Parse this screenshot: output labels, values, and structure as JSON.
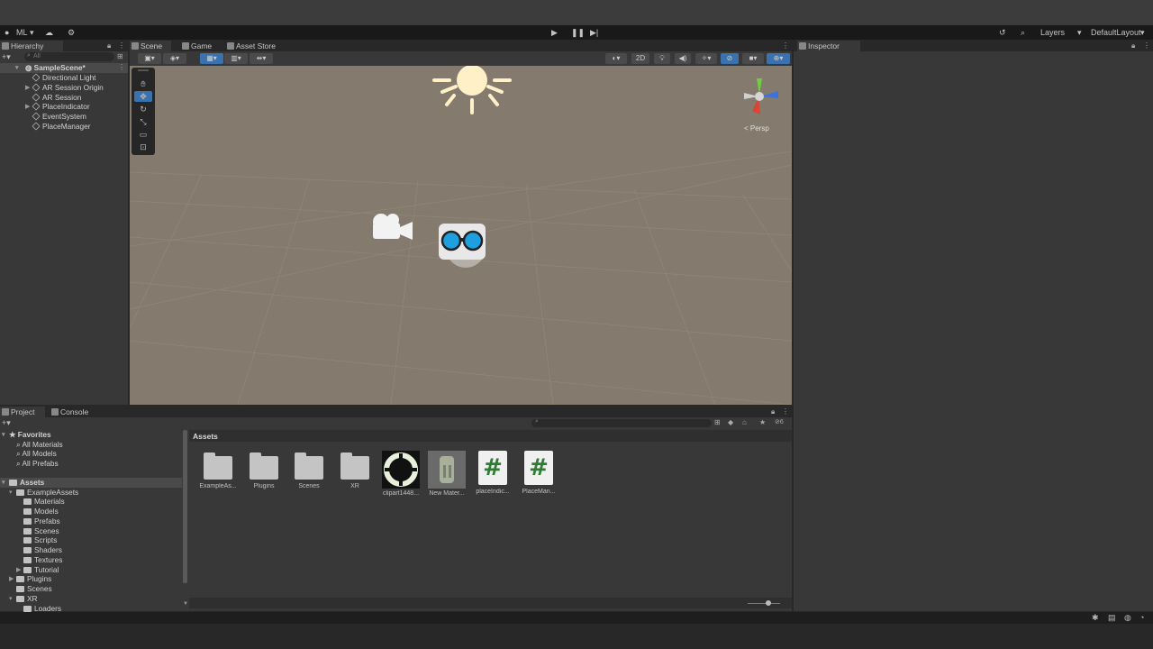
{
  "toolbar": {
    "account": "ML",
    "layers": "Layers",
    "layout": "DefaultLayout"
  },
  "hierarchy": {
    "tab": "Hierarchy",
    "search_placeholder": "All",
    "scene": "SampleScene*",
    "items": [
      "Directional Light",
      "AR Session Origin",
      "AR Session",
      "PlaceIndicator",
      "EventSystem",
      "PlaceManager"
    ]
  },
  "scene_tabs": {
    "scene": "Scene",
    "game": "Game",
    "asset_store": "Asset Store"
  },
  "scene_view": {
    "mode_2d": "2D",
    "persp": "< Persp"
  },
  "inspector": {
    "tab": "Inspector"
  },
  "project": {
    "tab": "Project",
    "console": "Console",
    "favorites": "Favorites",
    "fav_items": [
      "All Materials",
      "All Models",
      "All Prefabs"
    ],
    "assets": "Assets",
    "example_assets": "ExampleAssets",
    "example_children": [
      "Materials",
      "Models",
      "Prefabs",
      "Scenes",
      "Scripts",
      "Shaders",
      "Textures",
      "Tutorial"
    ],
    "root_items": [
      "Plugins",
      "Scenes",
      "XR"
    ],
    "xr_children": [
      "Loaders"
    ],
    "breadcrumb": "Assets",
    "hidden_count": "6"
  },
  "assets_grid": [
    "ExampleAs...",
    "Plugins",
    "Scenes",
    "XR",
    "clipart1448...",
    "New Mater...",
    "placeIndic...",
    "PlaceMan..."
  ],
  "colors": {
    "accent": "#3a72b0",
    "scene_bg": "#847a6d",
    "script_hash": "#2e7d32"
  }
}
